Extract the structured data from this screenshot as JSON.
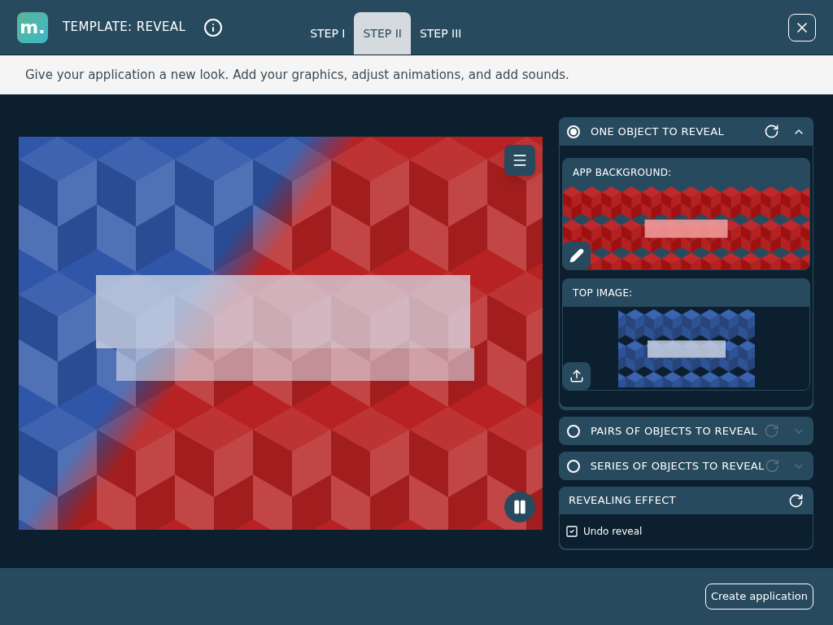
{
  "app": {
    "logo": "m.",
    "title": "TEMPLATE: REVEAL"
  },
  "tabs": [
    {
      "label": "STEP I",
      "selected": false
    },
    {
      "label": "STEP II",
      "selected": true
    },
    {
      "label": "STEP III",
      "selected": false
    }
  ],
  "subtitle": "Give your application a new look. Add your graphics, adjust animations, and add sounds.",
  "sections": [
    {
      "label": "ONE OBJECT TO REVEAL",
      "selected": true,
      "expanded": true,
      "images": [
        {
          "label": "APP BACKGROUND:",
          "kind": "edit"
        },
        {
          "label": "TOP IMAGE:",
          "kind": "upload"
        }
      ]
    },
    {
      "label": "PAIRS OF OBJECTS TO REVEAL",
      "selected": false,
      "expanded": false
    },
    {
      "label": "SERIES OF OBJECTS TO REVEAL",
      "selected": false,
      "expanded": false
    }
  ],
  "effect": {
    "title": "REVEALING EFFECT",
    "options": [
      {
        "label": "Undo reveal",
        "checked": true
      }
    ]
  },
  "create_button": "Create application"
}
